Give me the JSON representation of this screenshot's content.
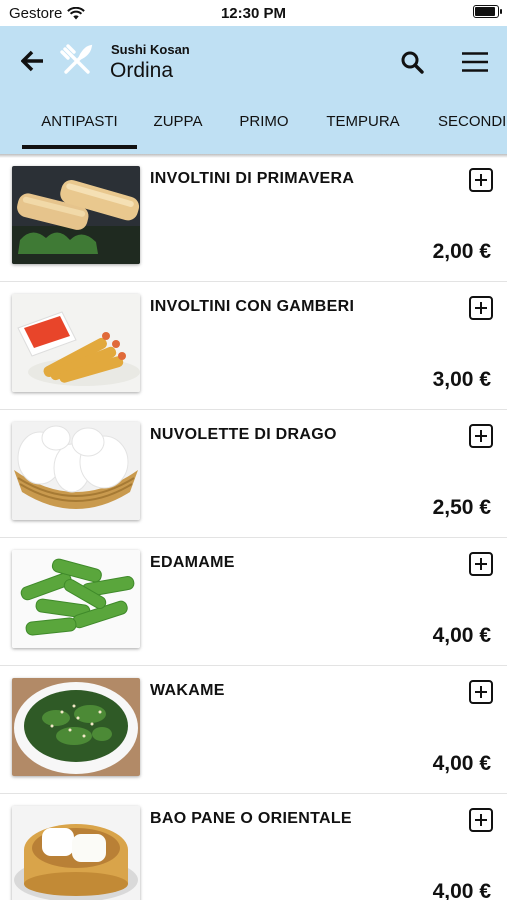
{
  "status_bar": {
    "carrier": "Gestore",
    "time": "12:30 PM"
  },
  "header": {
    "restaurant": "Sushi Kosan",
    "title": "Ordina"
  },
  "tabs": [
    {
      "label": "ANTIPASTI",
      "active": true
    },
    {
      "label": "ZUPPA"
    },
    {
      "label": "PRIMO"
    },
    {
      "label": "TEMPURA"
    },
    {
      "label": "SECONDI"
    }
  ],
  "items": [
    {
      "name": "INVOLTINI DI PRIMAVERA",
      "price": "2,00 €"
    },
    {
      "name": "INVOLTINI CON GAMBERI",
      "price": "3,00 €"
    },
    {
      "name": "NUVOLETTE DI DRAGO",
      "price": "2,50 €"
    },
    {
      "name": "EDAMAME",
      "price": "4,00 €"
    },
    {
      "name": "WAKAME",
      "price": "4,00 €"
    },
    {
      "name": "BAO PANE O ORIENTALE",
      "price": "4,00 €"
    }
  ],
  "colors": {
    "app_bar": "#bfe0f3",
    "text": "#111111"
  },
  "icons": [
    "back-arrow-icon",
    "cutlery-icon",
    "search-icon",
    "hamburger-menu-icon",
    "add-icon",
    "wifi-icon",
    "battery-icon"
  ]
}
